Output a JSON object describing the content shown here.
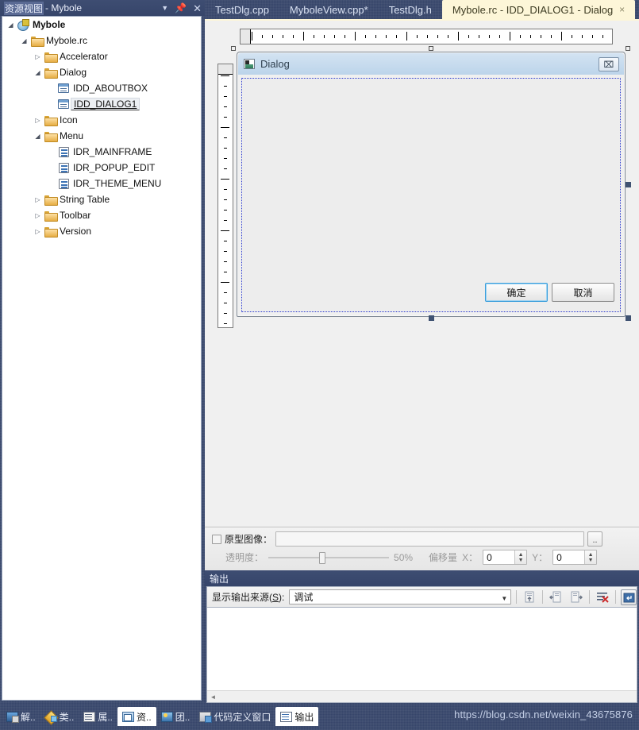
{
  "left_panel": {
    "title_highlight": "资源视图",
    "title_rest": "- Mybole",
    "icons": {
      "dropdown": "chevron-down-icon",
      "pin": "pin-icon",
      "close": "close-icon"
    },
    "tree": [
      {
        "label": "Mybole",
        "indent": 0,
        "expander": "open",
        "icon": "project-icon",
        "bold": true,
        "selected": false
      },
      {
        "label": "Mybole.rc",
        "indent": 1,
        "expander": "open",
        "icon": "folder-icon",
        "bold": false,
        "selected": false
      },
      {
        "label": "Accelerator",
        "indent": 2,
        "expander": "closed",
        "icon": "folder-icon",
        "bold": false,
        "selected": false
      },
      {
        "label": "Dialog",
        "indent": 2,
        "expander": "open",
        "icon": "folder-icon",
        "bold": false,
        "selected": false
      },
      {
        "label": "IDD_ABOUTBOX",
        "indent": 3,
        "expander": "none",
        "icon": "dialog-resource-icon",
        "bold": false,
        "selected": false
      },
      {
        "label": "IDD_DIALOG1",
        "indent": 3,
        "expander": "none",
        "icon": "dialog-resource-icon",
        "bold": false,
        "selected": true
      },
      {
        "label": "Icon",
        "indent": 2,
        "expander": "closed",
        "icon": "folder-icon",
        "bold": false,
        "selected": false
      },
      {
        "label": "Menu",
        "indent": 2,
        "expander": "open",
        "icon": "folder-icon",
        "bold": false,
        "selected": false
      },
      {
        "label": "IDR_MAINFRAME",
        "indent": 3,
        "expander": "none",
        "icon": "menu-resource-icon",
        "bold": false,
        "selected": false
      },
      {
        "label": "IDR_POPUP_EDIT",
        "indent": 3,
        "expander": "none",
        "icon": "menu-resource-icon",
        "bold": false,
        "selected": false
      },
      {
        "label": "IDR_THEME_MENU",
        "indent": 3,
        "expander": "none",
        "icon": "menu-resource-icon",
        "bold": false,
        "selected": false
      },
      {
        "label": "String Table",
        "indent": 2,
        "expander": "closed",
        "icon": "folder-icon",
        "bold": false,
        "selected": false
      },
      {
        "label": "Toolbar",
        "indent": 2,
        "expander": "closed",
        "icon": "folder-icon",
        "bold": false,
        "selected": false
      },
      {
        "label": "Version",
        "indent": 2,
        "expander": "closed",
        "icon": "folder-icon",
        "bold": false,
        "selected": false
      }
    ]
  },
  "editor_tabs": [
    {
      "label": "TestDlg.cpp",
      "active": false
    },
    {
      "label": "MyboleView.cpp*",
      "active": false
    },
    {
      "label": "TestDlg.h",
      "active": false
    },
    {
      "label": "Mybole.rc - IDD_DIALOG1 - Dialog",
      "active": true,
      "close": "×"
    }
  ],
  "designer": {
    "dialog": {
      "title": "Dialog",
      "app_icon": "dialog-app-icon",
      "close_label": "⌧",
      "buttons": [
        {
          "name": "ok",
          "label": "确定",
          "default": true
        },
        {
          "name": "cancel",
          "label": "取消",
          "default": false
        }
      ]
    }
  },
  "image_strip": {
    "checkbox_checked": false,
    "prototype_image_label": "原型图像：",
    "prototype_image_value": "",
    "browse_label": "..",
    "transparency_label": "透明度：",
    "transparency_value": "50%",
    "offset_label": "偏移量",
    "offset_x_label": "X：",
    "offset_x_value": "0",
    "offset_y_label": "Y：",
    "offset_y_value": "0"
  },
  "output_panel": {
    "title": "输出",
    "source_label_pre": "显示输出来源(",
    "source_label_key": "S",
    "source_label_post": "):",
    "source_value": "调试",
    "dropdown_arrow": "▼",
    "toolbar_icons": [
      "find-message-in-code-icon",
      "go-to-previous-message-icon",
      "go-to-next-message-icon",
      "clear-all-icon",
      "toggle-word-wrap-icon"
    ],
    "scroll_left_arrow": "◄",
    "content": ""
  },
  "bottom_tabs": [
    {
      "label": "解..",
      "icon": "solution-explorer-icon",
      "active": false
    },
    {
      "label": "类..",
      "icon": "class-view-icon",
      "active": false
    },
    {
      "label": "属..",
      "icon": "properties-icon",
      "active": false
    },
    {
      "label": "资..",
      "icon": "resource-view-icon",
      "active": true
    },
    {
      "label": "团..",
      "icon": "team-explorer-icon",
      "active": false
    },
    {
      "label": "代码定义窗口",
      "icon": "code-definition-window-icon",
      "active": false
    },
    {
      "label": "输出",
      "icon": "output-window-icon",
      "active": true
    }
  ],
  "watermark": {
    "url": "https://blog.csdn.net/weixin_43675876"
  },
  "colors": {
    "vs_chrome": "#36456a",
    "active_tab": "#fdf6d8",
    "panel_bg": "#f0f0f0",
    "dialog_titlebar": "#c9dcee",
    "default_button_border": "#3c9fdc",
    "selection_handle": "#3f5272"
  }
}
